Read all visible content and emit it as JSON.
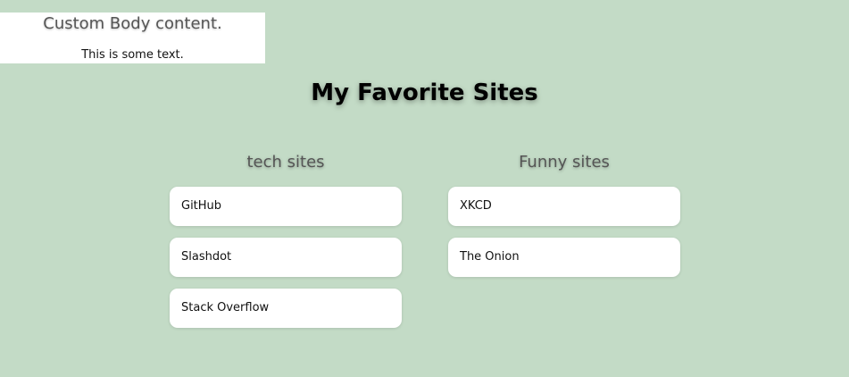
{
  "custom_body": {
    "title": "Custom Body content.",
    "text": "This is some text."
  },
  "page_title": "My Favorite Sites",
  "columns": [
    {
      "title": "tech sites",
      "sites": [
        "GitHub",
        "Slashdot",
        "Stack Overflow"
      ]
    },
    {
      "title": "Funny sites",
      "sites": [
        "XKCD",
        "The Onion"
      ]
    }
  ]
}
